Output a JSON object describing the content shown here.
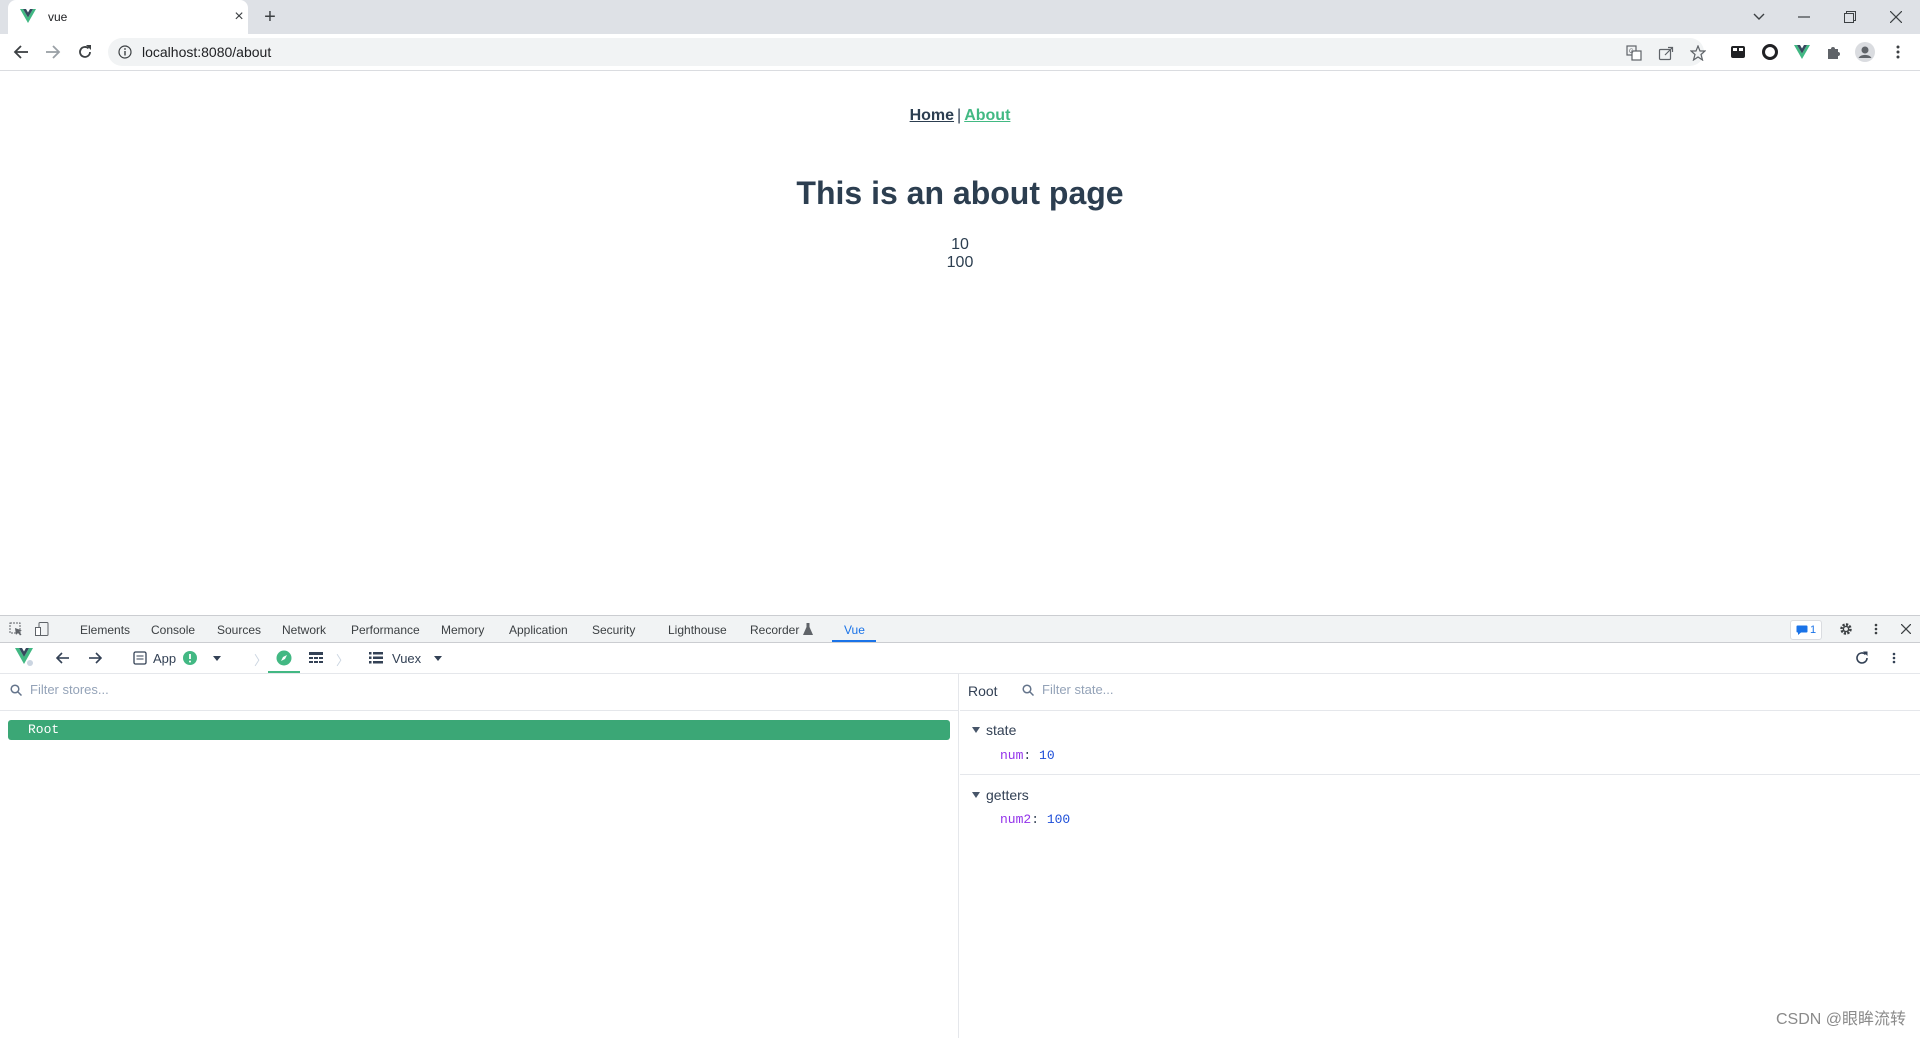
{
  "browser": {
    "tab_title": "vue",
    "tab_close": "×",
    "new_tab": "+",
    "url": "localhost:8080/about"
  },
  "page": {
    "nav": {
      "home": "Home",
      "separator": "|",
      "about": "About"
    },
    "heading": "This is an about page",
    "value_num": "10",
    "value_num2": "100"
  },
  "devtools": {
    "tabs": [
      "Elements",
      "Console",
      "Sources",
      "Network",
      "Performance",
      "Memory",
      "Application",
      "Security",
      "Lighthouse",
      "Recorder",
      "Vue"
    ],
    "active_tab": "Vue",
    "issues_count": "1",
    "vue": {
      "app_label": "App",
      "vuex_label": "Vuex",
      "filter_stores_placeholder": "Filter stores...",
      "stores": [
        "Root"
      ],
      "inspector_title": "Root",
      "filter_state_placeholder": "Filter state...",
      "state_label": "state",
      "state": [
        {
          "key": "num",
          "value": "10"
        }
      ],
      "getters_label": "getters",
      "getters": [
        {
          "key": "num2",
          "value": "100"
        }
      ]
    }
  },
  "watermark": "CSDN @眼眸流转",
  "colors": {
    "vue_green": "#42b983",
    "accent_blue": "#1a73e8",
    "root_row": "#3ba776"
  }
}
